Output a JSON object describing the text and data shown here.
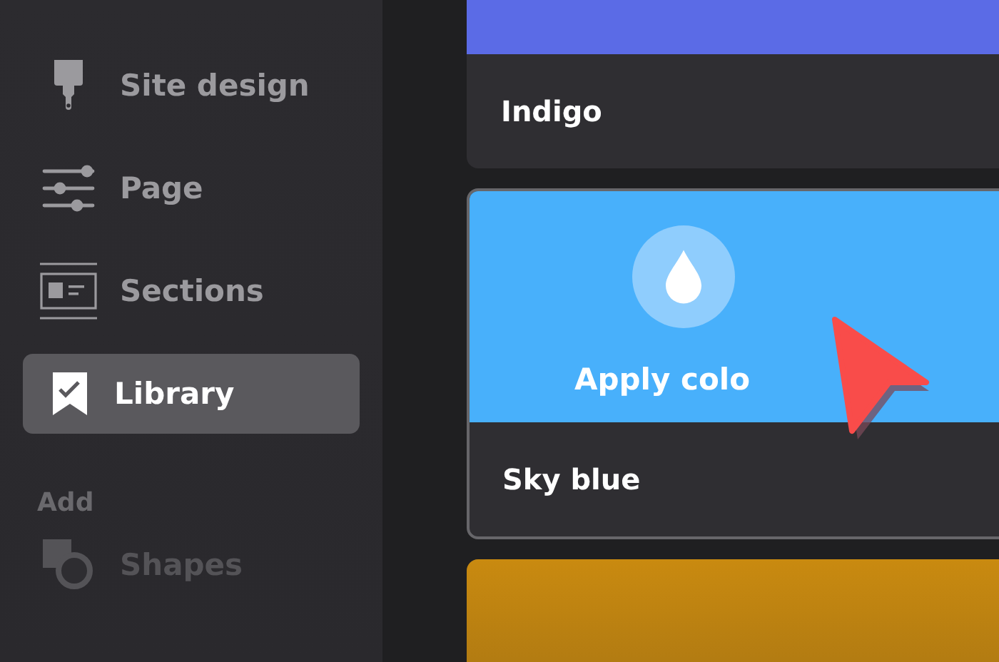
{
  "sidebar": {
    "items": [
      {
        "label": "Site design",
        "selected": false
      },
      {
        "label": "Page",
        "selected": false
      },
      {
        "label": "Sections",
        "selected": false
      },
      {
        "label": "Library",
        "selected": true
      }
    ],
    "add_heading": "Add",
    "add_items": [
      {
        "label": "Shapes",
        "disabled": true
      }
    ]
  },
  "cards": [
    {
      "color": "#5b6be6",
      "name": "Indigo",
      "hovered": false,
      "selected": false
    },
    {
      "color": "#48b0fb",
      "name": "Sky blue",
      "hovered": true,
      "selected": true,
      "action": "Apply colo"
    },
    {
      "color": "#c98a10",
      "hovered": false,
      "selected": false
    }
  ]
}
